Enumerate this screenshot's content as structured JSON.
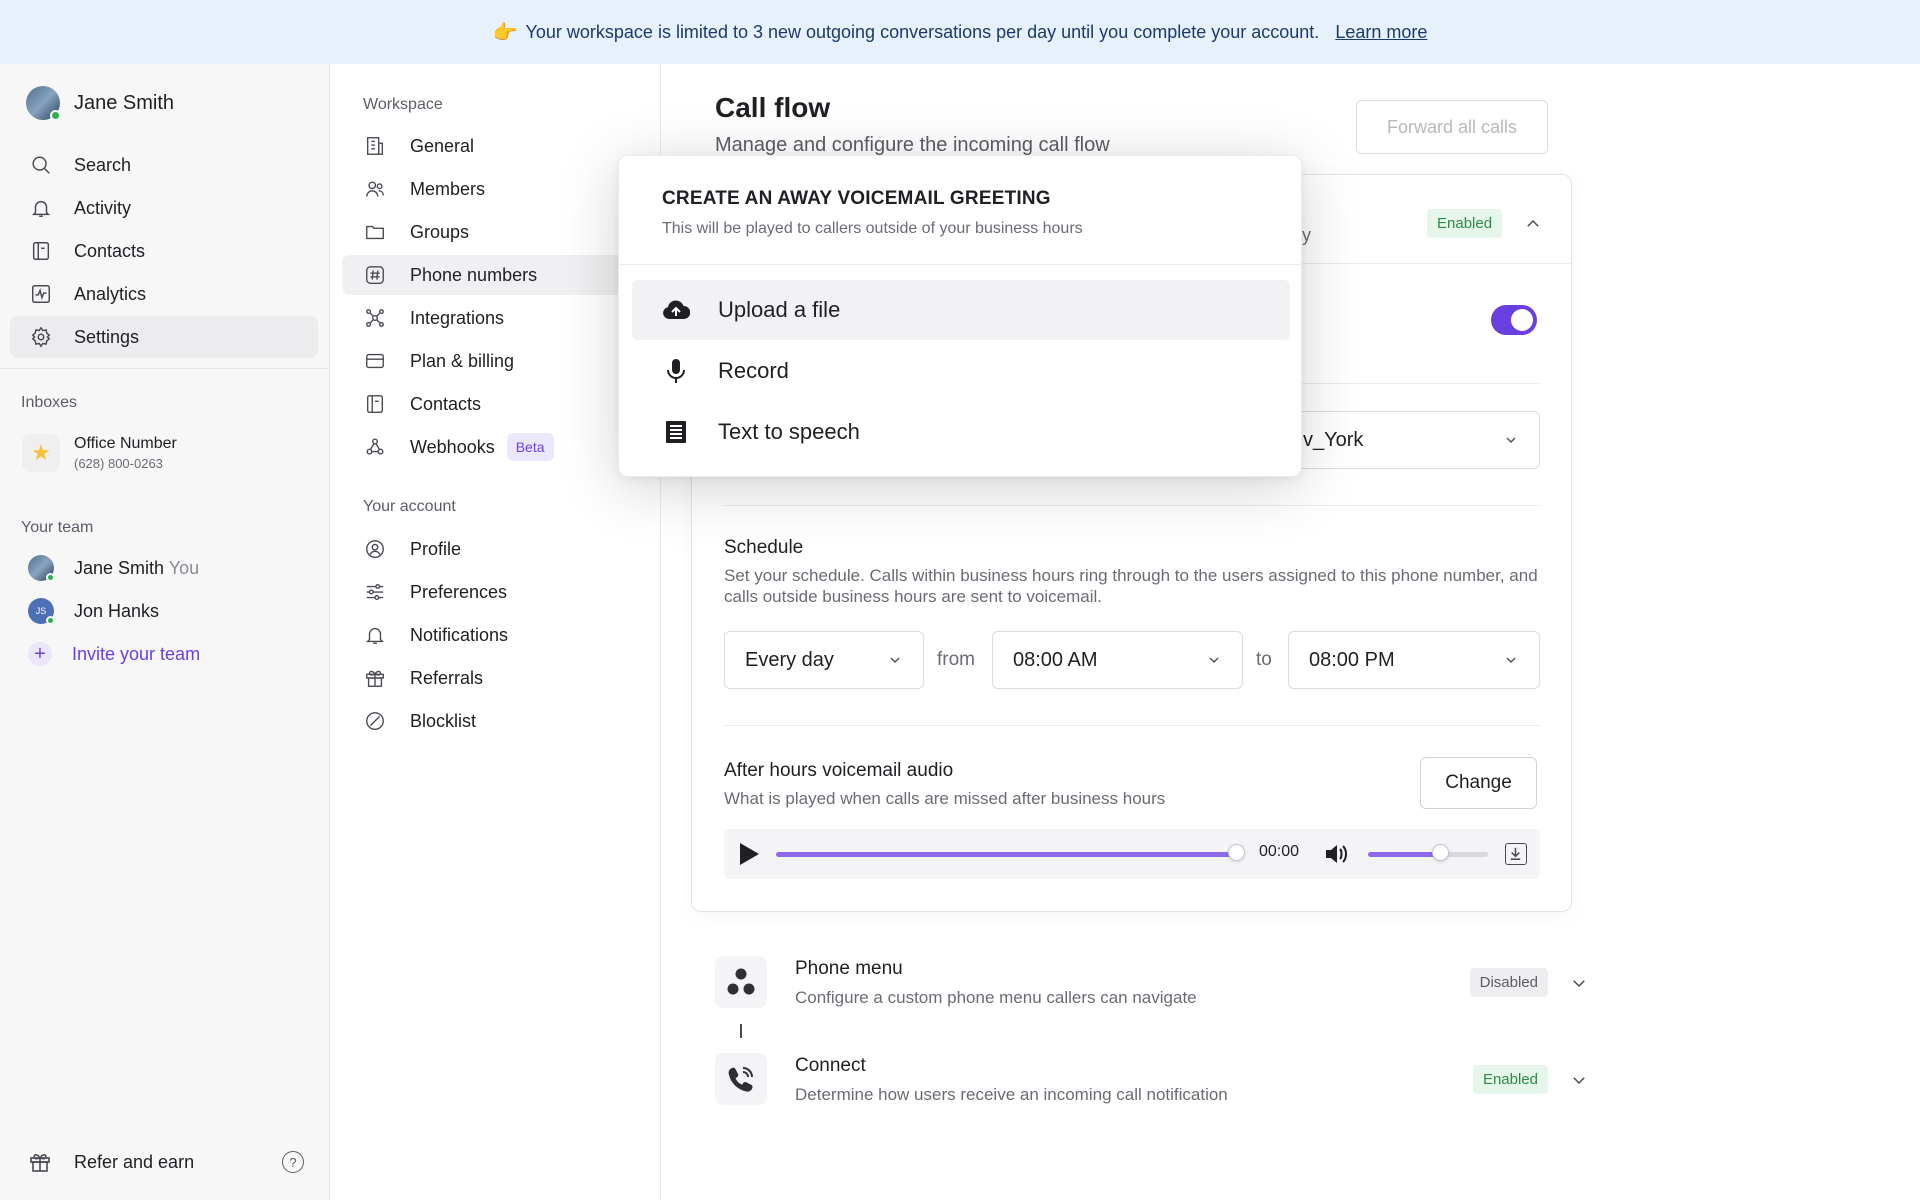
{
  "banner": {
    "icon": "pointing-hand-icon",
    "text": "Your workspace is limited to 3 new outgoing conversations per day until you complete your account.",
    "link": "Learn more"
  },
  "sidebar": {
    "user_name": "Jane Smith",
    "nav": [
      {
        "label": "Search",
        "icon": "search-icon"
      },
      {
        "label": "Activity",
        "icon": "bell-icon"
      },
      {
        "label": "Contacts",
        "icon": "contacts-icon"
      },
      {
        "label": "Analytics",
        "icon": "analytics-icon"
      },
      {
        "label": "Settings",
        "icon": "gear-icon",
        "active": true
      }
    ],
    "inboxes_label": "Inboxes",
    "inbox": {
      "name": "Office Number",
      "number": "(628) 800-0263"
    },
    "team_label": "Your team",
    "team": [
      {
        "name": "Jane Smith",
        "suffix": "You"
      },
      {
        "name": "Jon Hanks",
        "initials": "JS"
      }
    ],
    "invite": "Invite your team",
    "refer": "Refer and earn",
    "help": "?"
  },
  "settings": {
    "workspace_label": "Workspace",
    "workspace_items": [
      {
        "label": "General",
        "icon": "building-icon"
      },
      {
        "label": "Members",
        "icon": "users-icon"
      },
      {
        "label": "Groups",
        "icon": "folder-icon"
      },
      {
        "label": "Phone numbers",
        "icon": "hash-icon",
        "active": true
      },
      {
        "label": "Integrations",
        "icon": "integrations-icon"
      },
      {
        "label": "Plan & billing",
        "icon": "card-icon"
      },
      {
        "label": "Contacts",
        "icon": "contacts-icon"
      },
      {
        "label": "Webhooks",
        "icon": "webhook-icon",
        "badge": "Beta"
      }
    ],
    "account_label": "Your account",
    "account_items": [
      {
        "label": "Profile",
        "icon": "profile-icon"
      },
      {
        "label": "Preferences",
        "icon": "sliders-icon"
      },
      {
        "label": "Notifications",
        "icon": "bell-icon"
      },
      {
        "label": "Referrals",
        "icon": "gift-icon"
      },
      {
        "label": "Blocklist",
        "icon": "block-icon"
      }
    ]
  },
  "main": {
    "title": "Call flow",
    "subtitle": "Manage and configure the incoming call flow",
    "forward_button": "Forward all calls",
    "business_hours": {
      "header_tail": "y",
      "status": "Enabled",
      "timezone_visible": "v_York",
      "schedule_title": "Schedule",
      "schedule_desc": "Set your schedule. Calls within business hours ring through to the users assigned to this phone number, and calls outside business hours are sent to voicemail.",
      "days": "Every day",
      "from_label": "from",
      "from_time": "08:00 AM",
      "to_label": "to",
      "to_time": "08:00 PM",
      "after_hours_title": "After hours voicemail audio",
      "after_hours_desc": "What is played when calls are missed after business hours",
      "change_button": "Change",
      "player_time": "00:00",
      "player_progress": 1.0,
      "volume_level": 0.6
    },
    "steps": [
      {
        "title": "Phone menu",
        "desc": "Configure a custom phone menu callers can navigate",
        "status": "Disabled",
        "icon": "phone-menu-icon"
      },
      {
        "title": "Connect",
        "desc": "Determine how users receive an incoming call notification",
        "status": "Enabled",
        "icon": "phone-ringing-icon"
      }
    ]
  },
  "popover": {
    "title": "CREATE AN AWAY VOICEMAIL GREETING",
    "subtitle": "This will be played to callers outside of your business hours",
    "options": [
      {
        "label": "Upload a file",
        "icon": "cloud-upload-icon"
      },
      {
        "label": "Record",
        "icon": "microphone-icon"
      },
      {
        "label": "Text to speech",
        "icon": "document-lines-icon"
      }
    ]
  }
}
